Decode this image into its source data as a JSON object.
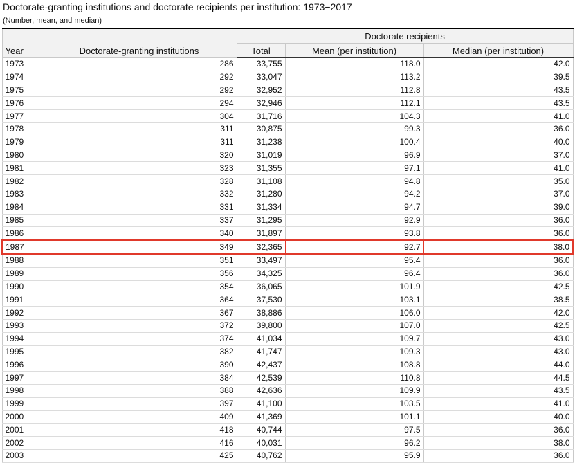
{
  "title": "Doctorate-granting institutions and doctorate recipients per institution: 1973−2017",
  "subtitle": "(Number, mean, and median)",
  "headers": {
    "group": "Doctorate recipients",
    "year": "Year",
    "institutions": "Doctorate-granting institutions",
    "total": "Total",
    "mean": "Mean (per institution)",
    "median": "Median (per institution)"
  },
  "highlight_color": "#e0392b",
  "highlighted_year": "1987",
  "rows": [
    [
      "1973",
      "286",
      "33,755",
      "118.0",
      "42.0"
    ],
    [
      "1974",
      "292",
      "33,047",
      "113.2",
      "39.5"
    ],
    [
      "1975",
      "292",
      "32,952",
      "112.8",
      "43.5"
    ],
    [
      "1976",
      "294",
      "32,946",
      "112.1",
      "43.5"
    ],
    [
      "1977",
      "304",
      "31,716",
      "104.3",
      "41.0"
    ],
    [
      "1978",
      "311",
      "30,875",
      "99.3",
      "36.0"
    ],
    [
      "1979",
      "311",
      "31,238",
      "100.4",
      "40.0"
    ],
    [
      "1980",
      "320",
      "31,019",
      "96.9",
      "37.0"
    ],
    [
      "1981",
      "323",
      "31,355",
      "97.1",
      "41.0"
    ],
    [
      "1982",
      "328",
      "31,108",
      "94.8",
      "35.0"
    ],
    [
      "1983",
      "332",
      "31,280",
      "94.2",
      "37.0"
    ],
    [
      "1984",
      "331",
      "31,334",
      "94.7",
      "39.0"
    ],
    [
      "1985",
      "337",
      "31,295",
      "92.9",
      "36.0"
    ],
    [
      "1986",
      "340",
      "31,897",
      "93.8",
      "36.0"
    ],
    [
      "1987",
      "349",
      "32,365",
      "92.7",
      "38.0"
    ],
    [
      "1988",
      "351",
      "33,497",
      "95.4",
      "36.0"
    ],
    [
      "1989",
      "356",
      "34,325",
      "96.4",
      "36.0"
    ],
    [
      "1990",
      "354",
      "36,065",
      "101.9",
      "42.5"
    ],
    [
      "1991",
      "364",
      "37,530",
      "103.1",
      "38.5"
    ],
    [
      "1992",
      "367",
      "38,886",
      "106.0",
      "42.0"
    ],
    [
      "1993",
      "372",
      "39,800",
      "107.0",
      "42.5"
    ],
    [
      "1994",
      "374",
      "41,034",
      "109.7",
      "43.0"
    ],
    [
      "1995",
      "382",
      "41,747",
      "109.3",
      "43.0"
    ],
    [
      "1996",
      "390",
      "42,437",
      "108.8",
      "44.0"
    ],
    [
      "1997",
      "384",
      "42,539",
      "110.8",
      "44.5"
    ],
    [
      "1998",
      "388",
      "42,636",
      "109.9",
      "43.5"
    ],
    [
      "1999",
      "397",
      "41,100",
      "103.5",
      "41.0"
    ],
    [
      "2000",
      "409",
      "41,369",
      "101.1",
      "40.0"
    ],
    [
      "2001",
      "418",
      "40,744",
      "97.5",
      "36.0"
    ],
    [
      "2002",
      "416",
      "40,031",
      "96.2",
      "38.0"
    ],
    [
      "2003",
      "425",
      "40,762",
      "95.9",
      "36.0"
    ]
  ]
}
